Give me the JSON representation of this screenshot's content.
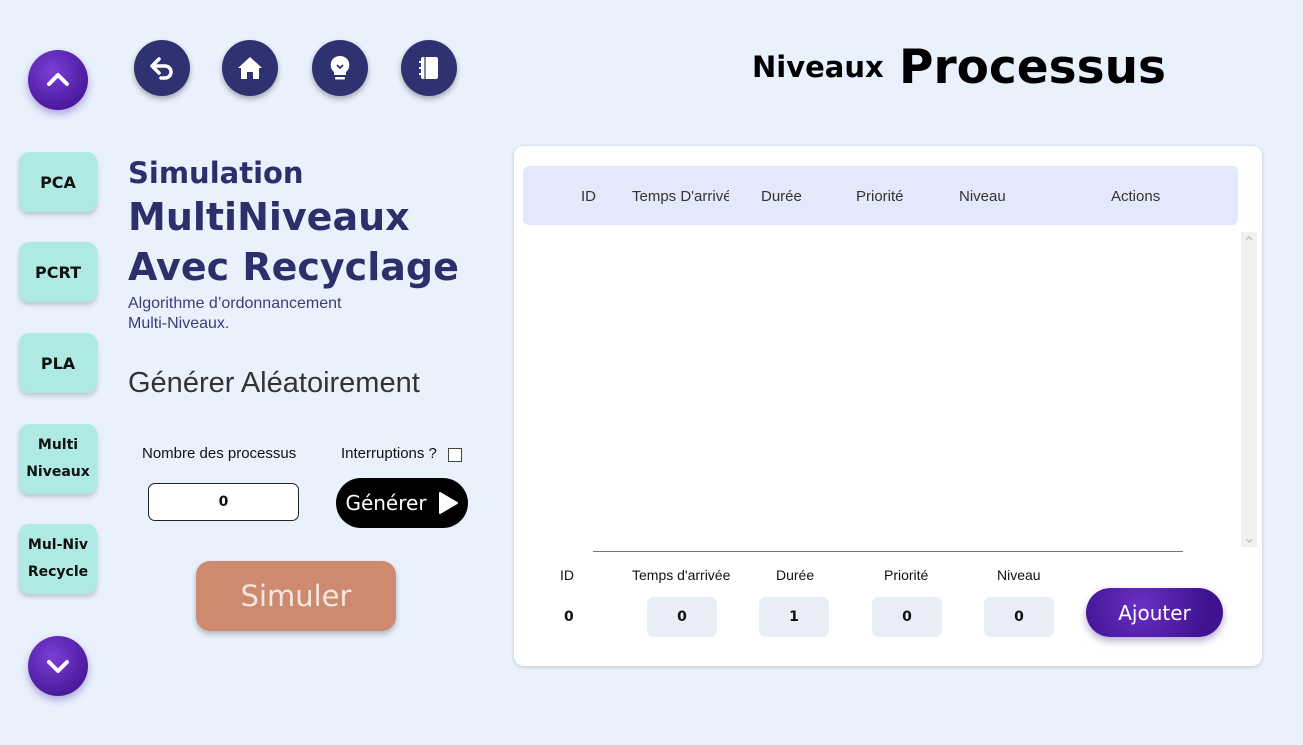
{
  "nav": {
    "up_icon": "chevron-up-icon",
    "down_icon": "chevron-down-icon",
    "algorithms": [
      {
        "line1": "PCA",
        "line2": ""
      },
      {
        "line1": "PCRT",
        "line2": ""
      },
      {
        "line1": "PLA",
        "line2": ""
      },
      {
        "line1": "Multi",
        "line2": "Niveaux"
      },
      {
        "line1": "Mul-Niv",
        "line2": "Recycle"
      }
    ]
  },
  "toolbar": {
    "icons": [
      "back-icon",
      "home-icon",
      "lightbulb-icon",
      "notebook-icon"
    ]
  },
  "header": {
    "small": "Niveaux",
    "big": "Processus"
  },
  "intro": {
    "title_line1": "Simulation",
    "title_line2": "MultiNiveaux",
    "title_line3": "Avec Recyclage",
    "desc_line1": "Algorithme d’ordonnancement",
    "desc_line2": "Multi-Niveaux."
  },
  "generator": {
    "title": "Générer Aléatoirement",
    "count_label": "Nombre des processus",
    "count_value": "0",
    "interrupt_label": "Interruptions ?",
    "interrupt_checked": false,
    "generate_label": "Générer",
    "simulate_label": "Simuler"
  },
  "table": {
    "columns": [
      "ID",
      "Temps D'arrivée",
      "Durée",
      "Priorité",
      "Niveau",
      "Actions"
    ],
    "rows": []
  },
  "form": {
    "labels": [
      "ID",
      "Temps d'arrivée",
      "Durée",
      "Priorité",
      "Niveau"
    ],
    "id_value": "0",
    "arrival_value": "0",
    "duration_value": "1",
    "priority_value": "0",
    "level_value": "0",
    "add_label": "Ajouter"
  },
  "colors": {
    "background": "#e9f1fd",
    "accent_purple": "#4c1a9e",
    "algo_button": "#aeeae3",
    "title_navy": "#2d2f6b",
    "simulate_button": "#cd8a6e"
  }
}
